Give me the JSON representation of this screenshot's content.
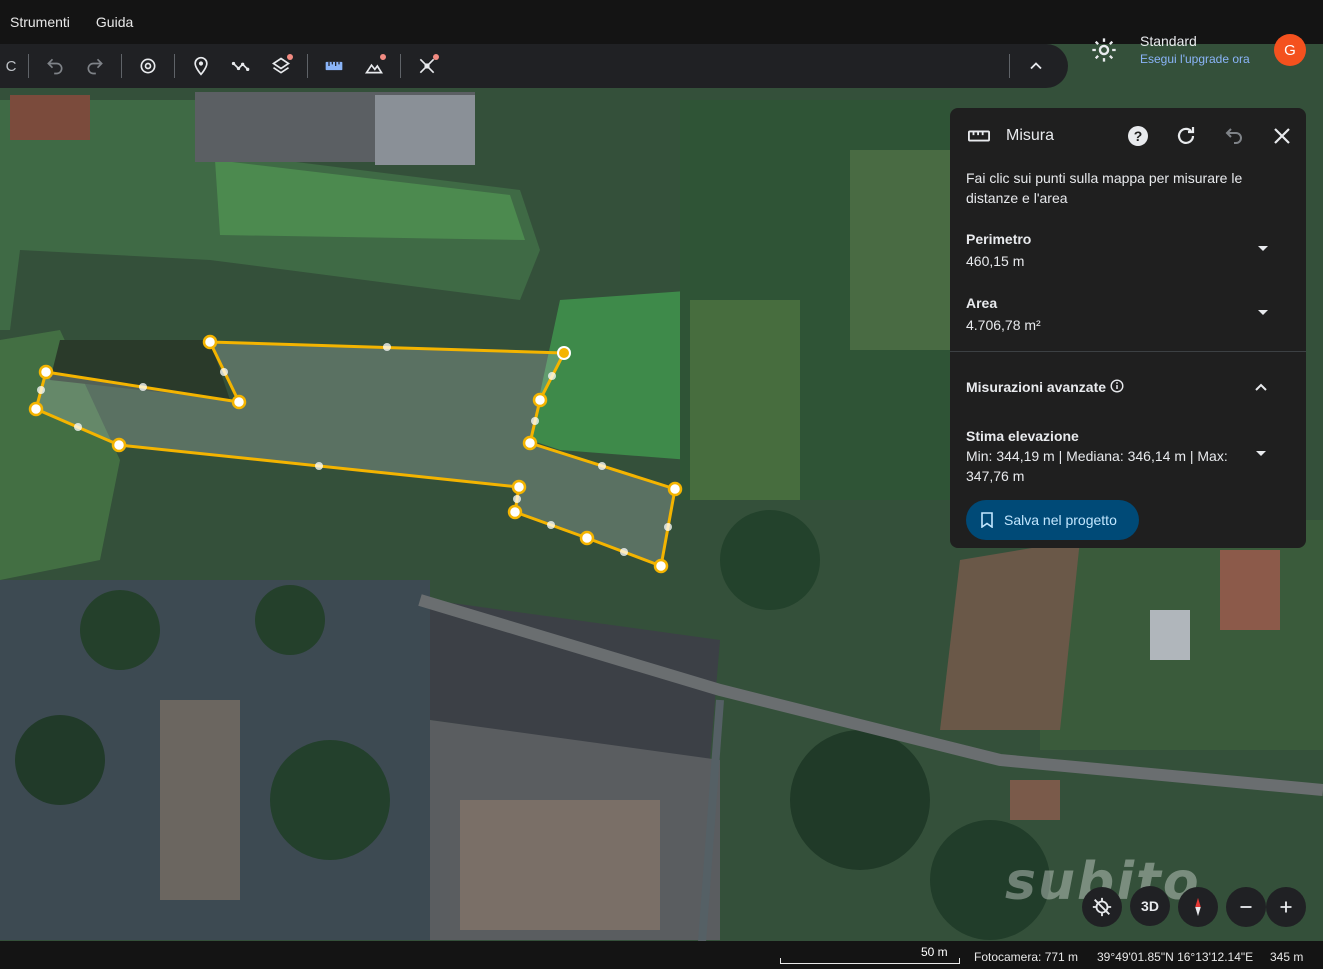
{
  "menu": {
    "tools": "Strumenti",
    "help": "Guida"
  },
  "toolbar": {
    "items": [
      "undo-icon",
      "redo-icon",
      "history-icon",
      "placemark-icon",
      "path-icon",
      "layers-icon",
      "ruler-icon",
      "elevation-icon",
      "satellite-tool-icon",
      "collapse-icon"
    ]
  },
  "account": {
    "plan": "Standard",
    "upgrade": "Esegui l'upgrade ora",
    "avatar_letter": "G"
  },
  "panel": {
    "title": "Misura",
    "instructions": "Fai clic sui punti sulla mappa per misurare le distanze e l'area",
    "perimeter_label": "Perimetro",
    "perimeter_value": "460,15 m",
    "area_label": "Area",
    "area_value": "4.706,78 m²",
    "advanced_label": "Misurazioni avanzate",
    "elevation_label": "Stima elevazione",
    "elevation_value": "Min: 344,19 m | Mediana: 346,14 m | Max: 347,76 m",
    "save_label": "Salva nel progetto"
  },
  "map_controls": {
    "three_d": "3D"
  },
  "status": {
    "scale": "50 m",
    "camera": "Fotocamera: 771 m",
    "coords": "39°49'01.85\"N 16°13'12.14\"E",
    "elevation": "345 m"
  },
  "watermark": "subito",
  "colors": {
    "measure_line": "#f4b400",
    "panel_bg": "#1f1f1f",
    "accent_button": "#004a77",
    "avatar": "#f4511e"
  }
}
